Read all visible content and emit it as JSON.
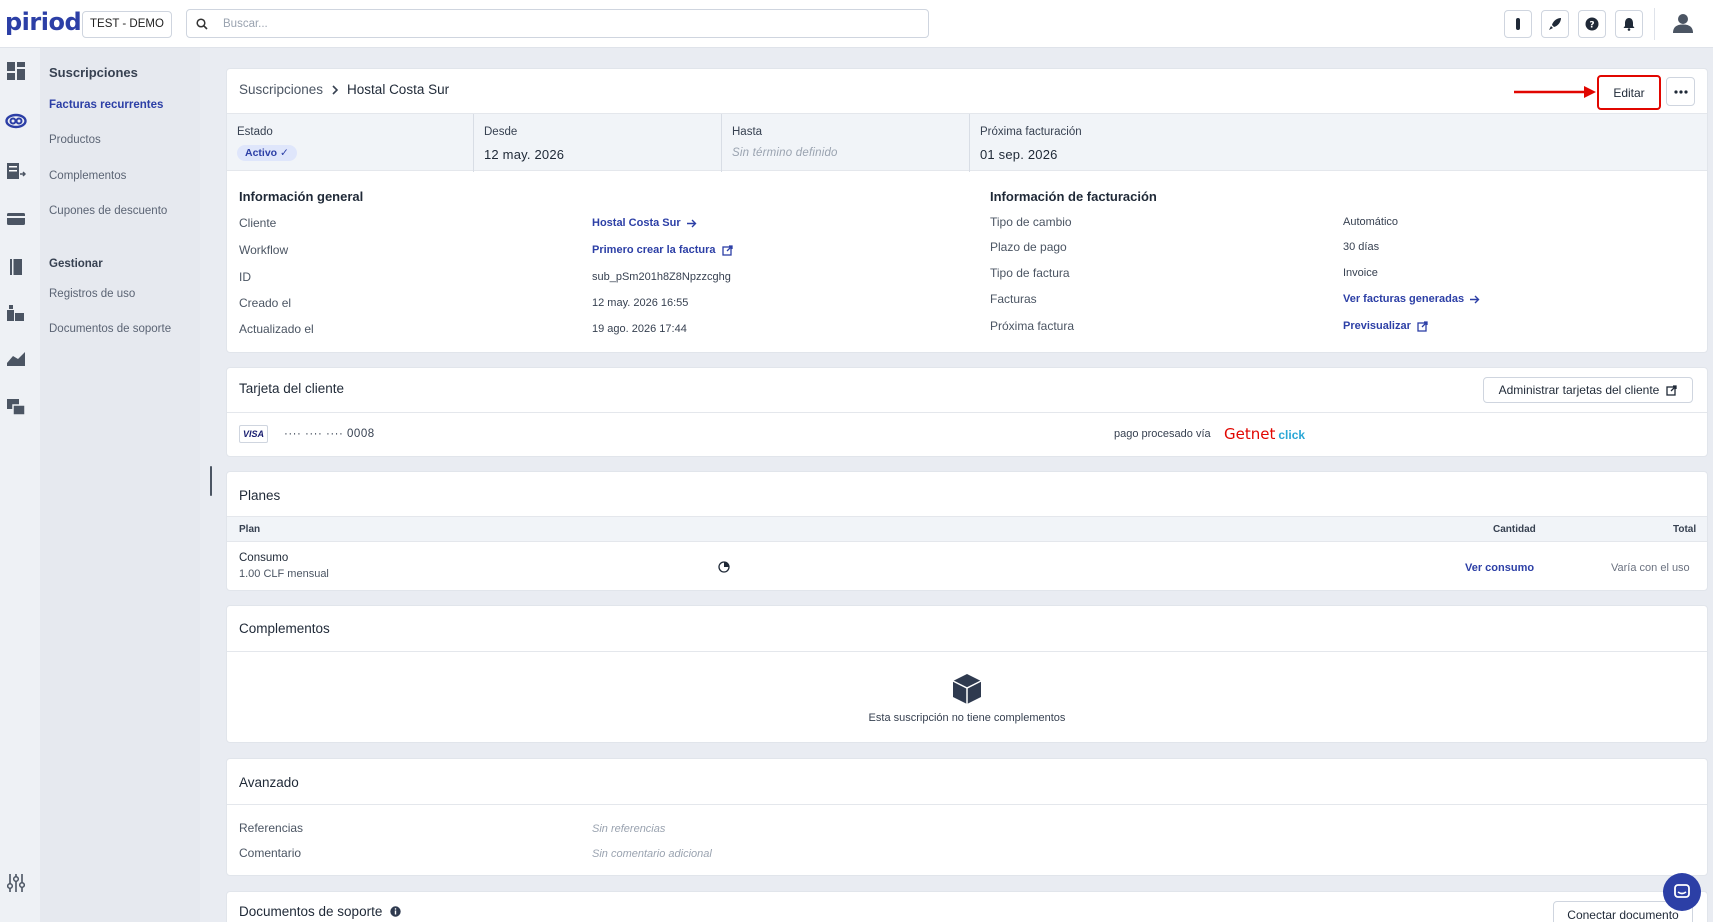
{
  "app": {
    "logo": "piriod",
    "environment": "TEST - DEMO",
    "search_placeholder": "Buscar..."
  },
  "topbar_icons": [
    "flask-icon",
    "rocket-icon",
    "help-icon",
    "bell-icon"
  ],
  "subnav": {
    "section1_title": "Suscripciones",
    "items1": [
      "Facturas recurrentes",
      "Productos",
      "Complementos",
      "Cupones de descuento"
    ],
    "section2_title": "Gestionar",
    "items2": [
      "Registros de uso",
      "Documentos de soporte"
    ]
  },
  "header": {
    "breadcrumb_parent": "Suscripciones",
    "breadcrumb_current": "Hostal Costa Sur",
    "edit_label": "Editar"
  },
  "status": {
    "estado_label": "Estado",
    "estado_value": "Activo ✓",
    "desde_label": "Desde",
    "desde_value": "12 may. 2026",
    "hasta_label": "Hasta",
    "hasta_value": "Sin término definido",
    "proxima_label": "Próxima facturación",
    "proxima_value": "01 sep. 2026"
  },
  "general": {
    "title": "Información general",
    "cliente_label": "Cliente",
    "cliente_value": "Hostal Costa Sur",
    "workflow_label": "Workflow",
    "workflow_value": "Primero crear la factura",
    "id_label": "ID",
    "id_value": "sub_pSm201h8Z8Npzzcghg",
    "creado_label": "Creado el",
    "creado_value": "12 may. 2026 16:55",
    "actualizado_label": "Actualizado el",
    "actualizado_value": "19 ago. 2026 17:44"
  },
  "billing": {
    "title": "Información de facturación",
    "tipo_cambio_label": "Tipo de cambio",
    "tipo_cambio_value": "Automático",
    "plazo_label": "Plazo de pago",
    "plazo_value": "30 días",
    "tipo_factura_label": "Tipo de factura",
    "tipo_factura_value": "Invoice",
    "facturas_label": "Facturas",
    "facturas_value": "Ver facturas generadas",
    "proxima_factura_label": "Próxima factura",
    "proxima_factura_value": "Previsualizar"
  },
  "card": {
    "title": "Tarjeta del cliente",
    "manage_label": "Administrar tarjetas del cliente",
    "brand": "VISA",
    "number": "···· ···· ···· 0008",
    "processed_label": "pago procesado vía",
    "processor_name": "Getnet",
    "processor_suffix": "click"
  },
  "plans": {
    "title": "Planes",
    "col_plan": "Plan",
    "col_cantidad": "Cantidad",
    "col_total": "Total",
    "rows": [
      {
        "name": "Consumo",
        "detail": "1.00 CLF mensual",
        "cantidad": "Ver consumo",
        "total": "Varía con el uso"
      }
    ]
  },
  "addons": {
    "title": "Complementos",
    "empty_text": "Esta suscripción no tiene complementos"
  },
  "advanced": {
    "title": "Avanzado",
    "ref_label": "Referencias",
    "ref_value": "Sin referencias",
    "comment_label": "Comentario",
    "comment_value": "Sin comentario adicional"
  },
  "support_docs": {
    "title": "Documentos de soporte",
    "connect_label": "Conectar documento"
  },
  "colors": {
    "brand": "#2c3fa6",
    "highlight": "#e10600",
    "getnet_red": "#e10600",
    "click_blue": "#2aa7d6"
  }
}
